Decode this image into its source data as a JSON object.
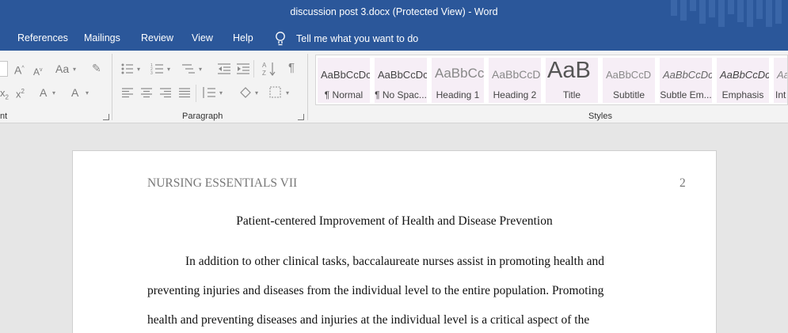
{
  "window": {
    "title": "discussion post 3.docx (Protected View)  -  Word"
  },
  "tabs": [
    {
      "label": "References"
    },
    {
      "label": "Mailings"
    },
    {
      "label": "Review"
    },
    {
      "label": "View"
    },
    {
      "label": "Help"
    }
  ],
  "tell_me": {
    "label": "Tell me what you want to do",
    "icon": "lightbulb-icon"
  },
  "ribbon": {
    "groups": [
      {
        "label": "nt"
      },
      {
        "label": "Paragraph"
      },
      {
        "label": "Styles"
      }
    ],
    "font_group": {
      "grow_font": "A",
      "shrink_font": "A",
      "change_case": "Aa",
      "subscript": "x",
      "superscript": "x",
      "text_effects": "A",
      "font_color": "A"
    },
    "paragraph_group": {
      "show_marks": "¶"
    },
    "styles": [
      {
        "sample": "AaBbCcDc",
        "name": "¶ Normal"
      },
      {
        "sample": "AaBbCcDc",
        "name": "¶ No Spac..."
      },
      {
        "sample": "AaBbCc",
        "name": "Heading 1"
      },
      {
        "sample": "AaBbCcD",
        "name": "Heading 2"
      },
      {
        "sample": "AaB",
        "name": "Title"
      },
      {
        "sample": "AaBbCcD",
        "name": "Subtitle"
      },
      {
        "sample": "AaBbCcDc",
        "name": "Subtle Em..."
      },
      {
        "sample": "AaBbCcDc",
        "name": "Emphasis"
      },
      {
        "sample": "Aa",
        "name": "Int"
      }
    ]
  },
  "document": {
    "header_left": "NURSING ESSENTIALS VII",
    "page_number": "2",
    "title": "Patient-centered Improvement of Health and Disease Prevention",
    "body_lines": [
      "In addition to other clinical tasks, baccalaureate nurses assist in promoting health and",
      "preventing injuries and diseases from the individual level to the entire population. Promoting",
      "health and preventing diseases and injuries at the individual level is a critical aspect of the"
    ]
  },
  "colors": {
    "brand_blue": "#2b579a",
    "ribbon_bg": "#f3f3f3",
    "canvas_bg": "#e6e6e6"
  }
}
